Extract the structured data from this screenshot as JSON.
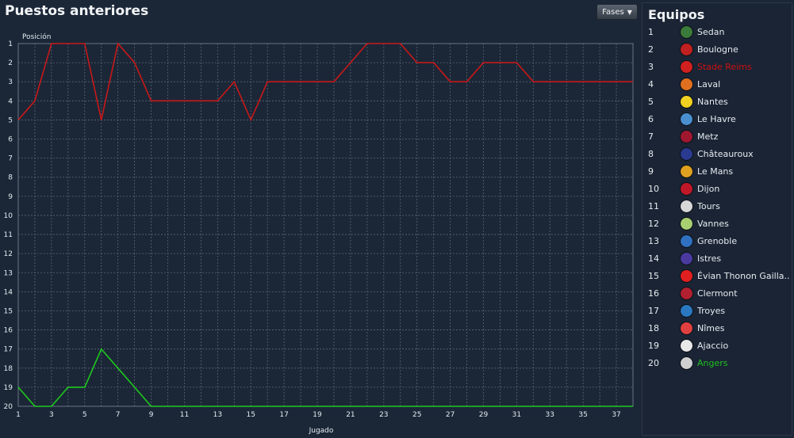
{
  "header": {
    "title": "Puestos anteriores",
    "fases_button": "Fases",
    "caret_icon": "chevron-down-icon"
  },
  "side_panel": {
    "title": "Equipos",
    "teams": [
      {
        "pos": "1",
        "name": "Sedan",
        "crest_color": "#3a7a3a",
        "name_color": "#e6ebf0"
      },
      {
        "pos": "2",
        "name": "Boulogne",
        "crest_color": "#c02020",
        "name_color": "#e6ebf0"
      },
      {
        "pos": "3",
        "name": "Stade Reims",
        "crest_color": "#d02020",
        "name_color": "#cc1111"
      },
      {
        "pos": "4",
        "name": "Laval",
        "crest_color": "#e07020",
        "name_color": "#e6ebf0"
      },
      {
        "pos": "5",
        "name": "Nantes",
        "crest_color": "#f0d020",
        "name_color": "#e6ebf0"
      },
      {
        "pos": "6",
        "name": "Le Havre",
        "crest_color": "#4a90d0",
        "name_color": "#e6ebf0"
      },
      {
        "pos": "7",
        "name": "Metz",
        "crest_color": "#a01830",
        "name_color": "#e6ebf0"
      },
      {
        "pos": "8",
        "name": "Châteauroux",
        "crest_color": "#2a3a90",
        "name_color": "#e6ebf0"
      },
      {
        "pos": "9",
        "name": "Le Mans",
        "crest_color": "#e0a020",
        "name_color": "#e6ebf0"
      },
      {
        "pos": "10",
        "name": "Dijon",
        "crest_color": "#c01828",
        "name_color": "#e6ebf0"
      },
      {
        "pos": "11",
        "name": "Tours",
        "crest_color": "#d8d8d8",
        "name_color": "#e6ebf0"
      },
      {
        "pos": "12",
        "name": "Vannes",
        "crest_color": "#a8d070",
        "name_color": "#e6ebf0"
      },
      {
        "pos": "13",
        "name": "Grenoble",
        "crest_color": "#3070c0",
        "name_color": "#e6ebf0"
      },
      {
        "pos": "14",
        "name": "Istres",
        "crest_color": "#4a3aa0",
        "name_color": "#e6ebf0"
      },
      {
        "pos": "15",
        "name": "Évian Thonon Gailla..",
        "crest_color": "#e02020",
        "name_color": "#e6ebf0"
      },
      {
        "pos": "16",
        "name": "Clermont",
        "crest_color": "#b02030",
        "name_color": "#e6ebf0"
      },
      {
        "pos": "17",
        "name": "Troyes",
        "crest_color": "#2a78c0",
        "name_color": "#e6ebf0"
      },
      {
        "pos": "18",
        "name": "Nîmes",
        "crest_color": "#e04040",
        "name_color": "#e6ebf0"
      },
      {
        "pos": "19",
        "name": "Ajaccio",
        "crest_color": "#e8e8e8",
        "name_color": "#e6ebf0"
      },
      {
        "pos": "20",
        "name": "Angers",
        "crest_color": "#d0d0d0",
        "name_color": "#20c020"
      }
    ]
  },
  "chart_data": {
    "type": "line",
    "title": "",
    "xlabel": "Jugado",
    "ylabel": "Posición",
    "xlim": [
      1,
      38
    ],
    "ylim": [
      1,
      20
    ],
    "y_inverted": true,
    "x_tick_labels": [
      "1",
      "3",
      "5",
      "7",
      "9",
      "11",
      "13",
      "15",
      "17",
      "19",
      "21",
      "23",
      "25",
      "27",
      "29",
      "31",
      "33",
      "35",
      "37"
    ],
    "y_tick_labels": [
      "1",
      "2",
      "3",
      "4",
      "5",
      "6",
      "7",
      "8",
      "9",
      "10",
      "11",
      "12",
      "13",
      "14",
      "15",
      "16",
      "17",
      "18",
      "19",
      "20"
    ],
    "grid": true,
    "series": [
      {
        "name": "Stade Reims",
        "color": "#c81818",
        "x": [
          1,
          2,
          3,
          4,
          5,
          6,
          7,
          8,
          9,
          10,
          11,
          12,
          13,
          14,
          15,
          16,
          17,
          18,
          19,
          20,
          21,
          22,
          23,
          24,
          25,
          26,
          27,
          28,
          29,
          30,
          31,
          32,
          33,
          34,
          35,
          36,
          37,
          38
        ],
        "values": [
          5,
          4,
          1,
          1,
          1,
          5,
          1,
          2,
          4,
          4,
          4,
          4,
          4,
          3,
          5,
          3,
          3,
          3,
          3,
          3,
          2,
          1,
          1,
          1,
          2,
          2,
          3,
          3,
          2,
          2,
          2,
          3,
          3,
          3,
          3,
          3,
          3,
          3
        ]
      },
      {
        "name": "Angers",
        "color": "#1ec81e",
        "x": [
          1,
          2,
          3,
          4,
          5,
          6,
          7,
          8,
          9,
          10,
          11,
          12,
          13,
          14,
          15,
          16,
          17,
          18,
          19,
          20,
          21,
          22,
          23,
          24,
          25,
          26,
          27,
          28,
          29,
          30,
          31,
          32,
          33,
          34,
          35,
          36,
          37,
          38
        ],
        "values": [
          19,
          20,
          20,
          19,
          19,
          17,
          18,
          19,
          20,
          20,
          20,
          20,
          20,
          20,
          20,
          20,
          20,
          20,
          20,
          20,
          20,
          20,
          20,
          20,
          20,
          20,
          20,
          20,
          20,
          20,
          20,
          20,
          20,
          20,
          20,
          20,
          20,
          20
        ]
      }
    ]
  }
}
